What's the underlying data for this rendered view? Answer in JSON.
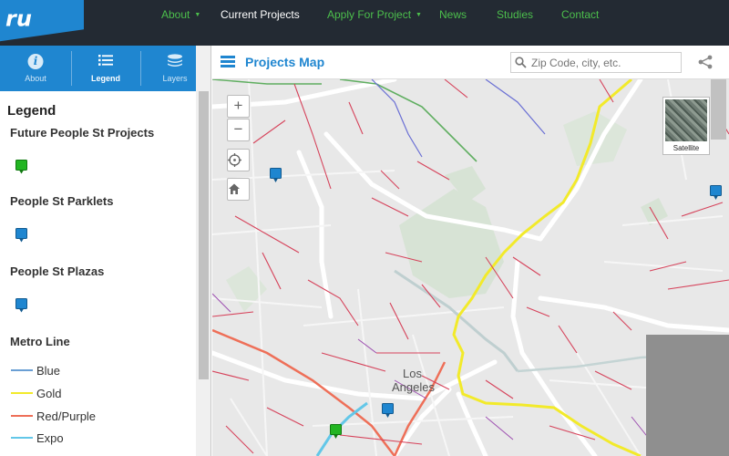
{
  "logo": {
    "text": "ru"
  },
  "nav": {
    "items": [
      {
        "label": "About",
        "dropdown": true,
        "active": false
      },
      {
        "label": "Current Projects",
        "dropdown": false,
        "active": true
      },
      {
        "label": "Apply For Project",
        "dropdown": true,
        "active": false
      },
      {
        "label": "News",
        "dropdown": false,
        "active": false
      },
      {
        "label": "Studies",
        "dropdown": false,
        "active": false
      },
      {
        "label": "Contact",
        "dropdown": false,
        "active": false
      }
    ]
  },
  "sidebar": {
    "tabs": [
      {
        "label": "About",
        "icon": "info-icon",
        "active": false
      },
      {
        "label": "Legend",
        "icon": "list-icon",
        "active": true
      },
      {
        "label": "Layers",
        "icon": "layers-icon",
        "active": false
      }
    ],
    "legend": {
      "title": "Legend",
      "sections": [
        {
          "title": "Future People St Projects",
          "pin_color": "#22b522"
        },
        {
          "title": "People St Parklets",
          "pin_color": "#1f86d0"
        },
        {
          "title": "People St Plazas",
          "pin_color": "#1f86d0"
        }
      ],
      "metro_title": "Metro Line",
      "metro_lines": [
        {
          "name": "Blue",
          "color": "#6a9fd4"
        },
        {
          "name": "Gold",
          "color": "#f2ea2a"
        },
        {
          "name": "Red/Purple",
          "color": "#ee6f58"
        },
        {
          "name": "Expo",
          "color": "#63c7e8"
        }
      ]
    }
  },
  "map": {
    "title": "Projects Map",
    "search_placeholder": "Zip Code, city, etc.",
    "satellite_label": "Satellite",
    "city_label_1": "Los",
    "city_label_2": "Angeles",
    "zoom_in": "+",
    "zoom_out": "−"
  },
  "colors": {
    "accent": "#1f86d0",
    "nav_bg": "#232a33",
    "nav_link": "#4cbf4c"
  }
}
